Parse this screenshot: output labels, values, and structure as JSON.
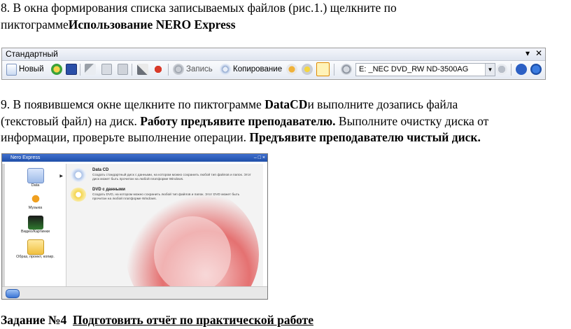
{
  "p1": {
    "line1": "8. В окна формирования списка записываемых файлов (рис.1.) щелкните по",
    "line2_normal": "пиктограмме",
    "line2_bold": "Использование NERO Express"
  },
  "toolbar": {
    "title": "Стандартный",
    "menu_arrow": "▾",
    "close": "✕",
    "new_label": "Новый",
    "write_label": "Запись",
    "copy_label": "Копирование",
    "drive_value": "E: _NEC DVD_RW ND-3500AG"
  },
  "p2": {
    "l1_a": "9. В появившемся окне щелкните по пиктограмме ",
    "l1_b": "DataCD",
    "l1_c": "и выполните дозапись файла",
    "l2_a": "(текстовый файл) на диск. ",
    "l2_b": "Работу предъявите преподавателю.",
    "l2_c": " Выполните очистку диска от",
    "l3_a": "информации, проверьте выполнение операции. ",
    "l3_b": "Предъявите преподавателю чистый диск."
  },
  "nero": {
    "title": "Nero Express",
    "sidebar": [
      "Data",
      "Музыка",
      "Видео/Картинки",
      "Образ, проект, копир."
    ],
    "options": [
      {
        "title": "Data CD",
        "desc": "Создать стандартный диск с данными, на котором можно сохранить любой тип файлов и папок. Этот диск может быть прочитан на любой платформе Windows."
      },
      {
        "title": "DVD с данными",
        "desc": "Создать DVD, на котором можно сохранить любой тип файлов и папок. Этот DVD может быть прочитан на любой платформе Windows."
      }
    ]
  },
  "task": {
    "label": "Задание №4",
    "text": "Подготовить отчёт по практической работе"
  }
}
